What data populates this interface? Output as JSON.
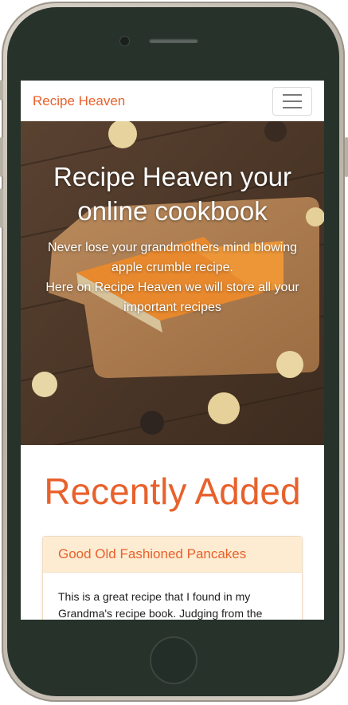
{
  "navbar": {
    "brand": "Recipe Heaven",
    "menu_icon": "hamburger-menu-icon"
  },
  "hero": {
    "title": "Recipe Heaven your online cookbook",
    "subtitle_line1": "Never lose your grandmothers mind blowing apple crumble recipe.",
    "subtitle_line2": "Here on Recipe Heaven we will store all your important recipes"
  },
  "recent": {
    "heading": "Recently Added",
    "cards": [
      {
        "title": "Good Old Fashioned Pancakes",
        "excerpt": "This is a great recipe that I found in my Grandma's recipe book. Judging from the"
      }
    ]
  },
  "colors": {
    "accent": "#e8612c",
    "card_header_bg": "#fdecd2",
    "phone_body": "#27322b"
  }
}
